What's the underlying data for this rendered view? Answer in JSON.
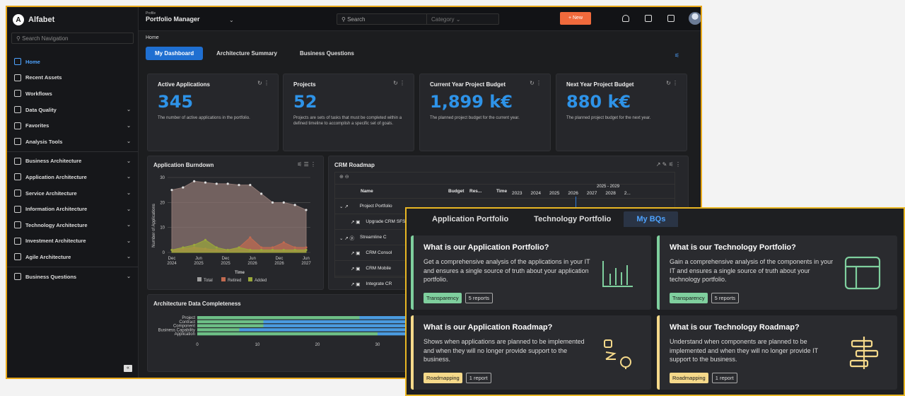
{
  "app": {
    "name": "Alfabet",
    "logo_letter": "A"
  },
  "sidebar": {
    "search_placeholder": "Search Navigation",
    "items": [
      {
        "label": "Home",
        "chevron": ""
      },
      {
        "label": "Recent Assets",
        "chevron": ""
      },
      {
        "label": "Workflows",
        "chevron": ""
      },
      {
        "label": "Data Quality",
        "chevron": "⌄"
      },
      {
        "label": "Favorites",
        "chevron": "⌄"
      },
      {
        "label": "Analysis Tools",
        "chevron": "⌄"
      },
      {
        "label": "Business Architecture",
        "chevron": "⌄"
      },
      {
        "label": "Application Architecture",
        "chevron": "⌄"
      },
      {
        "label": "Service Architecture",
        "chevron": "⌄"
      },
      {
        "label": "Information Architecture",
        "chevron": "⌄"
      },
      {
        "label": "Technology Architecture",
        "chevron": "⌄"
      },
      {
        "label": "Investment Architecture",
        "chevron": "⌄"
      },
      {
        "label": "Agile Architecture",
        "chevron": "⌄"
      },
      {
        "label": "Business Questions",
        "chevron": "⌄"
      }
    ],
    "collapse": "«"
  },
  "topbar": {
    "profile_label": "Profile",
    "profile_value": "Portfolio Manager",
    "search_placeholder": "Search",
    "category": "Category",
    "new_button": "+ New"
  },
  "main": {
    "breadcrumb": "Home",
    "tabs": [
      "My Dashboard",
      "Architecture Summary",
      "Business Questions"
    ]
  },
  "kpis": [
    {
      "title": "Active Applications",
      "value": "345",
      "desc": "The number of active applications in the portfolio."
    },
    {
      "title": "Projects",
      "value": "52",
      "desc": "Projects are sets of tasks that must be completed within a defined timeline to accomplish a specific set of goals."
    },
    {
      "title": "Current Year Project Budget",
      "value": "1,899 k€",
      "desc": "The planned project budget for the current year."
    },
    {
      "title": "Next Year Project Budget",
      "value": "880 k€",
      "desc": "The planned project budget for the next year."
    }
  ],
  "burndown": {
    "title": "Application Burndown",
    "ylabel": "Number of Applications",
    "xlabel": "Time",
    "y_ticks": [
      "0",
      "10",
      "20",
      "30"
    ],
    "x_ticks": [
      [
        "Dec",
        "2024"
      ],
      [
        "Jun",
        "2025"
      ],
      [
        "Dec",
        "2025"
      ],
      [
        "Jun",
        "2026"
      ],
      [
        "Dec",
        "2026"
      ],
      [
        "Jun",
        "2027"
      ]
    ],
    "legend": [
      "Total",
      "Retired",
      "Added"
    ]
  },
  "chart_data": [
    {
      "type": "area",
      "title": "Application Burndown",
      "xlabel": "Time",
      "ylabel": "Number of Applications",
      "ylim": [
        0,
        30
      ],
      "x": [
        "Dec 2024",
        "Jun 2025",
        "Dec 2025",
        "Jun 2026",
        "Dec 2026",
        "Jun 2027"
      ],
      "series": [
        {
          "name": "Total",
          "values": [
            25,
            26,
            28.5,
            28,
            27.5,
            27.5,
            27,
            27,
            23.5,
            20,
            20,
            19,
            17
          ]
        },
        {
          "name": "Retired",
          "values": [
            1,
            1.5,
            2,
            1.5,
            1,
            1,
            2,
            6,
            2,
            2,
            4,
            2,
            2
          ]
        },
        {
          "name": "Added",
          "values": [
            1,
            2,
            3,
            5,
            2,
            1,
            2,
            1,
            1,
            1,
            1,
            1,
            1
          ]
        }
      ]
    },
    {
      "type": "bar",
      "title": "Architecture Data Completeness",
      "categories": [
        "Project",
        "Contract",
        "Component",
        "Business Capability",
        "Application"
      ],
      "xlim": [
        0,
        40
      ],
      "x_ticks": [
        "0",
        "10",
        "20",
        "30",
        "40"
      ],
      "series": [
        {
          "name": "",
          "values": [
            27,
            11,
            11,
            7,
            30
          ]
        },
        {
          "name": "",
          "values": [
            15,
            31,
            31,
            35,
            8
          ]
        },
        {
          "name": "",
          "values": [
            0,
            0,
            0,
            0,
            5
          ]
        }
      ]
    }
  ],
  "roadmap": {
    "title": "CRM Roadmap",
    "headers": [
      "Name",
      "Budget",
      "Res...",
      "Time"
    ],
    "period": "2025 - 2029",
    "years": [
      "2023",
      "2024",
      "2025",
      "2026",
      "2027",
      "2028",
      "2..."
    ],
    "rows": [
      "Project Portfolio",
      "Upgrade CRM SFS",
      "Streamline C",
      "CRM Consol",
      "CRM Mobile",
      "Integrate CR"
    ]
  },
  "completeness": {
    "title": "Architecture Data Completeness",
    "categories": [
      "Project",
      "Contract",
      "Component",
      "Business Capability",
      "Application"
    ],
    "x_ticks": [
      "0",
      "10",
      "20",
      "30",
      "40"
    ]
  },
  "bq": {
    "tabs": [
      "Application Portfolio",
      "Technology Portfolio",
      "My BQs"
    ],
    "cards": [
      {
        "title": "What is our Application Portfolio?",
        "desc": "Get a comprehensive analysis of the applications in your IT and ensures a single source of truth about your application portfolio.",
        "tag": "Transparency",
        "reports": "5 reports",
        "color": "#7fcf9e"
      },
      {
        "title": "What is our Technology Portfolio?",
        "desc": "Gain a comprehensive analysis of the components in your IT and ensures a single source of truth about your technology portfolio.",
        "tag": "Transparency",
        "reports": "5 reports",
        "color": "#7fcf9e"
      },
      {
        "title": "What is our Application Roadmap?",
        "desc": "Shows when applications are planned to be implemented and when they will no longer provide support to the business.",
        "tag": "Roadmapping",
        "reports": "1 report",
        "color": "#f5d98a"
      },
      {
        "title": "What is our Technology Roadmap?",
        "desc": "Understand when components are planned to be implemented and when they will no longer provide IT support to the business.",
        "tag": "Roadmapping",
        "reports": "1 report",
        "color": "#f5d98a"
      }
    ]
  }
}
